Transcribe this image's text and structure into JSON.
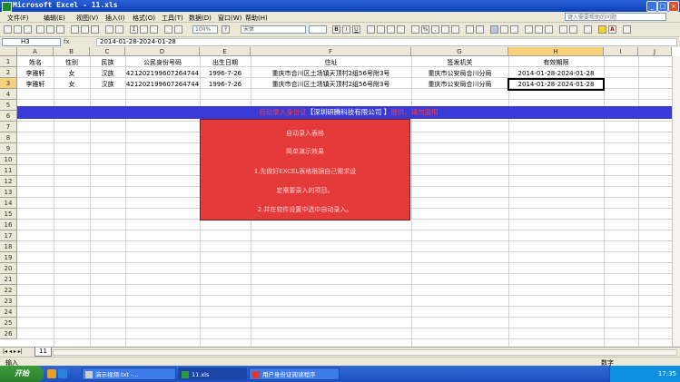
{
  "window": {
    "title": "Microsoft Excel - 11.xls"
  },
  "menu": [
    "文件(F)",
    "编辑(E)",
    "视图(V)",
    "插入(I)",
    "格式(O)",
    "工具(T)",
    "数据(D)",
    "窗口(W)",
    "帮助(H)"
  ],
  "help_box": "键入需要帮助的问题",
  "toolbar": {
    "zoom": "100%",
    "font": "宋体"
  },
  "formula_bar": {
    "cell_ref": "H3",
    "fx": "fx",
    "content": "2014-01-28-2024-01-28"
  },
  "columns": [
    "A",
    "B",
    "C",
    "D",
    "E",
    "F",
    "G",
    "H",
    "I",
    "J"
  ],
  "rows": [
    "1",
    "2",
    "3",
    "4",
    "5",
    "6",
    "7",
    "8",
    "9",
    "10",
    "11",
    "12",
    "13",
    "14",
    "15",
    "16",
    "17",
    "18",
    "19",
    "20",
    "21",
    "22",
    "23",
    "24",
    "25",
    "26"
  ],
  "table": {
    "headers": [
      "姓名",
      "性别",
      "民族",
      "公民身份号码",
      "出生日期",
      "住址",
      "签发机关",
      "有效期限"
    ],
    "rows": [
      [
        "李雅轩",
        "女",
        "汉族",
        "421202199607264744",
        "1996-7-26",
        "重庆市合川区土场镇天顶村2组56号附3号",
        "重庆市公安局合川分局",
        "2014-01-28-2024-01-28"
      ],
      [
        "李雅轩",
        "女",
        "汉族",
        "421202199607264744",
        "1996-7-26",
        "重庆市合川区土场镇天顶村2组56号附3号",
        "重庆市公安局合川分局",
        "2014-01-28-2024-01-28"
      ]
    ]
  },
  "banner": {
    "pre": "自动录入身份证",
    "company": "【深圳研腾科技有限公司 】",
    "post": "提供，请勿盗用"
  },
  "overlay": {
    "lines": [
      "自动录入表格",
      "简单演示效果",
      "1.先做好EXCEL表格根据自己需求设",
      "定需要录入的项目。",
      "2.并在软件设置中选中自动录入。"
    ]
  },
  "sheet_tab": "11",
  "status": {
    "left": "输入",
    "right": "数字"
  },
  "taskbar": {
    "start": "开始",
    "items": [
      "演示视频.txt -...",
      "11.xls",
      "用户身份证阅读程序"
    ],
    "clock": "17:35"
  },
  "colors": {
    "banner_bg": "#3a3ad8",
    "overlay_bg": "#e53a3a",
    "selected_header": "#f8d27a"
  }
}
